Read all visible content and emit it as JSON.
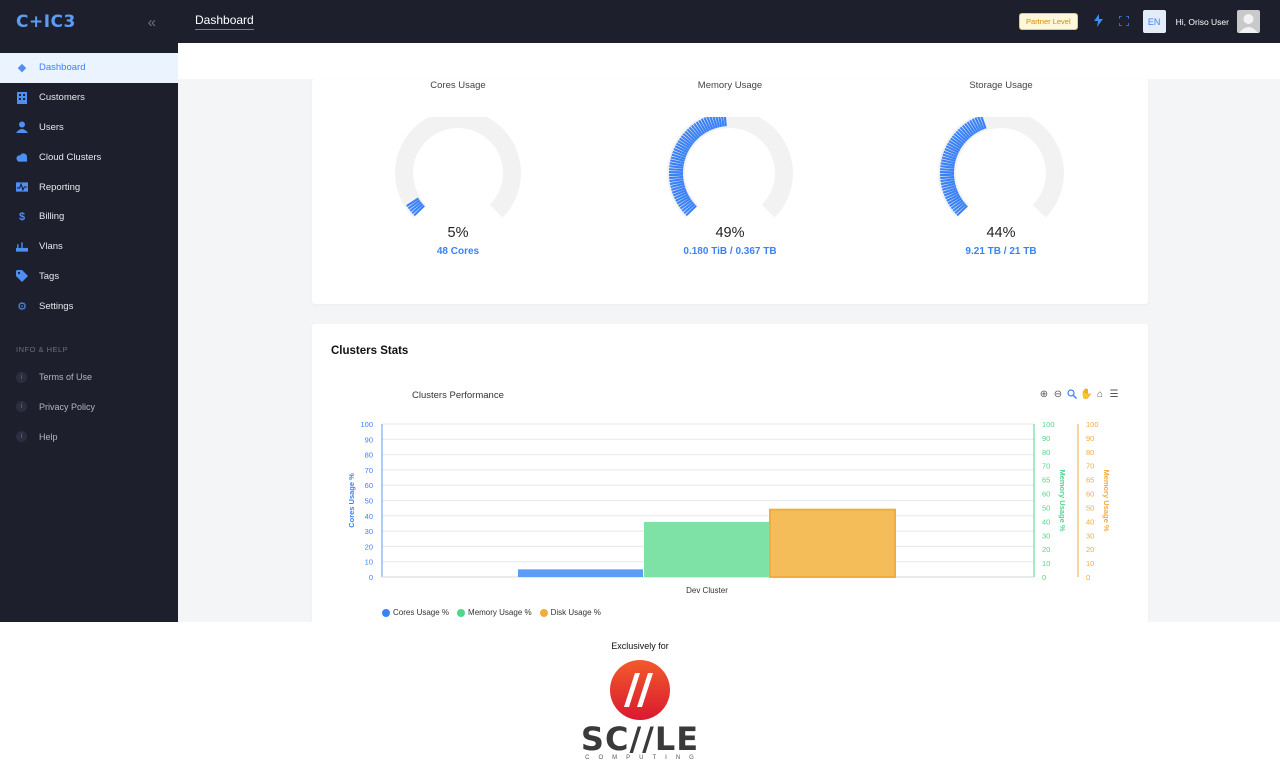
{
  "app": {
    "logo": "C+IC3",
    "collapse_icon": "chevrons-left-icon",
    "page_title": "Dashboard"
  },
  "sidebar": {
    "items": [
      {
        "label": "Dashboard",
        "icon": "diamond-icon",
        "active": true
      },
      {
        "label": "Customers",
        "icon": "building-icon"
      },
      {
        "label": "Users",
        "icon": "user-icon"
      },
      {
        "label": "Cloud Clusters",
        "icon": "cloud-icon"
      },
      {
        "label": "Reporting",
        "icon": "activity-icon"
      },
      {
        "label": "Billing",
        "icon": "dollar-icon"
      },
      {
        "label": "Vlans",
        "icon": "network-icon"
      },
      {
        "label": "Tags",
        "icon": "tag-icon"
      },
      {
        "label": "Settings",
        "icon": "gear-icon"
      }
    ],
    "section_label": "INFO & HELP",
    "help_items": [
      {
        "label": "Terms of Use"
      },
      {
        "label": "Privacy Policy"
      },
      {
        "label": "Help"
      }
    ]
  },
  "topbar": {
    "badge": "Partner Level",
    "language": "EN",
    "greeting": "Hi, Oriso User"
  },
  "gauges": [
    {
      "title": "Cores Usage",
      "percent": 5,
      "percent_label": "5%",
      "detail": "48 Cores"
    },
    {
      "title": "Memory Usage",
      "percent": 49,
      "percent_label": "49%",
      "detail": "0.180 TiB / 0.367 TB"
    },
    {
      "title": "Storage Usage",
      "percent": 44,
      "percent_label": "44%",
      "detail": "9.21 TB / 21 TB"
    }
  ],
  "stats": {
    "title": "Clusters Stats"
  },
  "chart_data": {
    "type": "bar",
    "title": "Clusters Performance",
    "categories": [
      "Dev Cluster"
    ],
    "series": [
      {
        "name": "Cores Usage %",
        "values": [
          5
        ],
        "color": "#5b9cf5"
      },
      {
        "name": "Memory Usage %",
        "values": [
          36
        ],
        "color": "#7ee2a6"
      },
      {
        "name": "Disk Usage %",
        "values": [
          44
        ],
        "color": "#f5bd5a"
      }
    ],
    "ylabel_left": "Cores Usage %",
    "ylabel_right_1": "Memory Usage %",
    "ylabel_right_2": "Memory Usage %",
    "ylim": [
      0,
      100
    ],
    "ticks": [
      "0",
      "10",
      "20",
      "30",
      "40",
      "50",
      "60",
      "70",
      "80",
      "90",
      "100"
    ],
    "right_ticks": [
      "0",
      "10",
      "20",
      "30",
      "40",
      "50",
      "60",
      "65",
      "70",
      "80",
      "90",
      "100"
    ],
    "grid": true,
    "legend_position": "bottom-left"
  },
  "footer": {
    "exclusive_text": "Exclusively for",
    "brand_word": "SC//LE",
    "brand_sub": "COMPUTING"
  },
  "colors": {
    "accent": "#3b82f6",
    "sidebar_bg": "#1e1f2c",
    "gauge_track": "#f2f2f2",
    "brand_red": "#e5322d"
  }
}
